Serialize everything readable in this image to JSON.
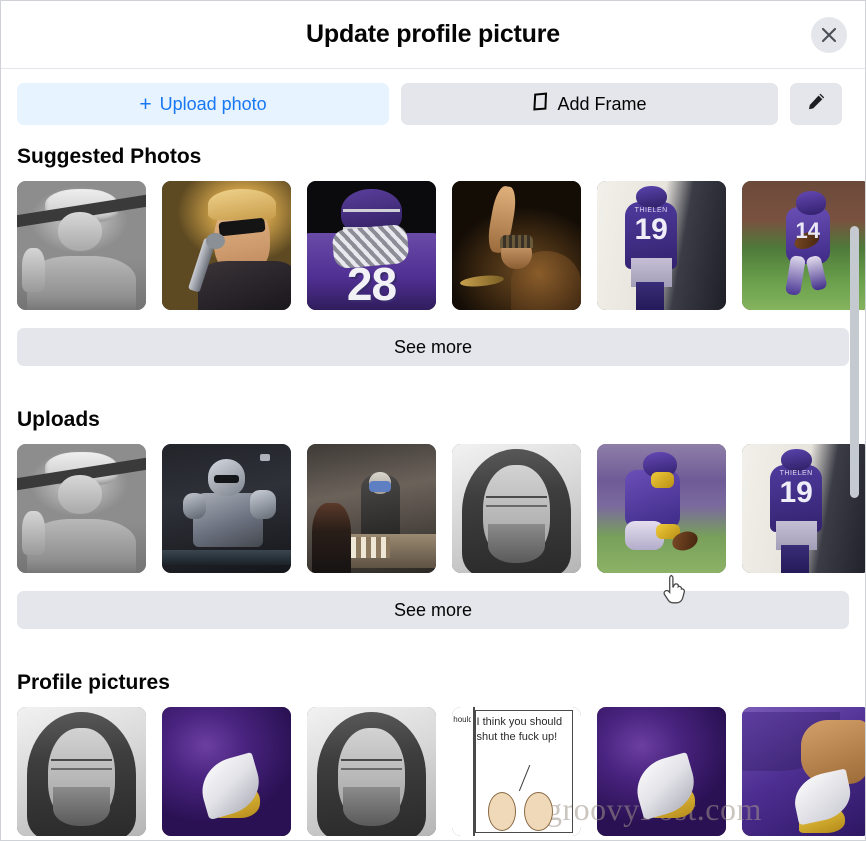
{
  "dialog": {
    "title": "Update profile picture",
    "close_icon": "close-icon"
  },
  "toolbar": {
    "upload_photo_label": "Upload photo",
    "upload_plus": "+",
    "add_frame_label": "Add Frame",
    "add_frame_icon": "frame-icon",
    "edit_icon": "pencil-icon"
  },
  "colors": {
    "accent_blue": "#1877f2",
    "upload_button_bg": "#e7f3ff",
    "neutral_button_bg": "#e4e6eb",
    "text_primary": "#050505",
    "scrollbar_thumb": "#c5c9d0"
  },
  "sections": [
    {
      "title": "Suggested Photos",
      "see_more_label": "See more",
      "photos": [
        {
          "alt": "Black and white man in beanie pointing",
          "art": "art-bw-beanie"
        },
        {
          "alt": "Singer with sunglasses holding microphone",
          "art": "art-singer"
        },
        {
          "alt": "Football player number 28 with crossed gloves",
          "art": "art-fb28",
          "number": "28"
        },
        {
          "alt": "Drummer with raised arm on stage",
          "art": "art-drummer"
        },
        {
          "alt": "Football player Thielen number 19 from behind",
          "art": "art-fb19",
          "number": "19",
          "name": "THIELEN"
        },
        {
          "alt": "Football player number 14 running with ball",
          "art": "art-fb14",
          "number": "14"
        }
      ]
    },
    {
      "title": "Uploads",
      "see_more_label": "See more",
      "photos": [
        {
          "alt": "Black and white man in beanie pointing",
          "art": "art-bw-beanie"
        },
        {
          "alt": "Mandalorian armored figure",
          "art": "art-mando"
        },
        {
          "alt": "Bernie Sanders chess meme at table",
          "art": "art-chess"
        },
        {
          "alt": "Black and white hooded selfie with glasses",
          "art": "art-hood"
        },
        {
          "alt": "Football player kneeling in purple jersey",
          "art": "art-kneel"
        },
        {
          "alt": "Football player Thielen number 19 from behind",
          "art": "art-fb19",
          "number": "19",
          "name": "THIELEN"
        }
      ]
    },
    {
      "title": "Profile pictures",
      "photos": [
        {
          "alt": "Black and white hooded selfie with glasses",
          "art": "art-hood"
        },
        {
          "alt": "Vikings horn logo on purple swirl",
          "art": "art-viking"
        },
        {
          "alt": "Black and white hooded selfie with glasses",
          "art": "art-hood"
        },
        {
          "alt": "Comic strip with two characters",
          "art": "art-comic",
          "line1": "hould",
          "line2": "I think you should shut the fuck up!"
        },
        {
          "alt": "Vikings horn logo on purple background",
          "art": "art-viking"
        },
        {
          "alt": "Vikings helmet logo on purple background",
          "art": "art-viking2"
        }
      ]
    }
  ],
  "watermark": "groovyPost.com"
}
